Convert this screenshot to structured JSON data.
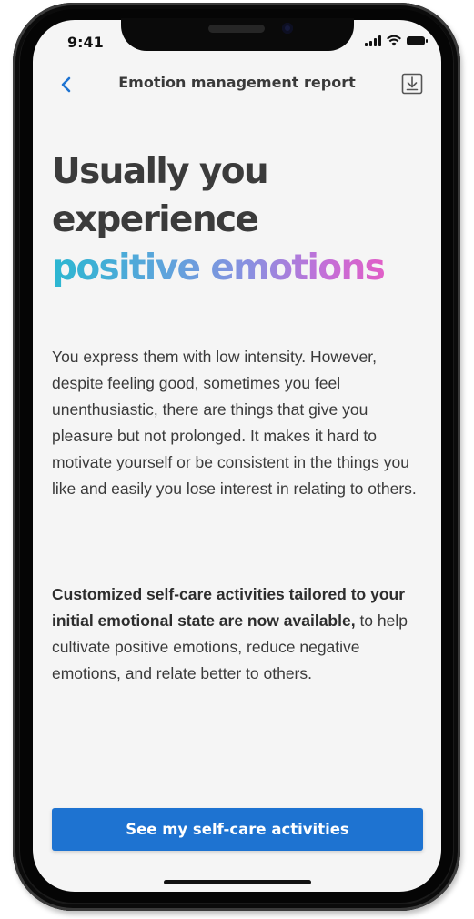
{
  "status_bar": {
    "time": "9:41"
  },
  "navbar": {
    "title": "Emotion management report",
    "back_icon": "chevron-left-icon",
    "download_icon": "download-icon"
  },
  "headline": {
    "line1": "Usually you",
    "line2": "experience",
    "line3": "positive emotions"
  },
  "body": {
    "paragraph1": "You express them with low intensity. However, despite feeling good, sometimes you feel unenthusiastic, there are things that give you pleasure but not prolonged. It makes it hard to motivate yourself or be consistent in the things you like and easily you lose interest in relating to others.",
    "paragraph2_bold": "Customized self-care activities tailored to your initial emotional state are now available,",
    "paragraph2_rest": " to help cultivate positive emotions, reduce negative emotions, and relate better to others."
  },
  "cta": {
    "label": "See my self-care activities"
  },
  "colors": {
    "accent": "#1e73d1",
    "gradient_start": "#2bb7d1",
    "gradient_end": "#e05fc7",
    "headline_text": "#3b3b3b"
  }
}
